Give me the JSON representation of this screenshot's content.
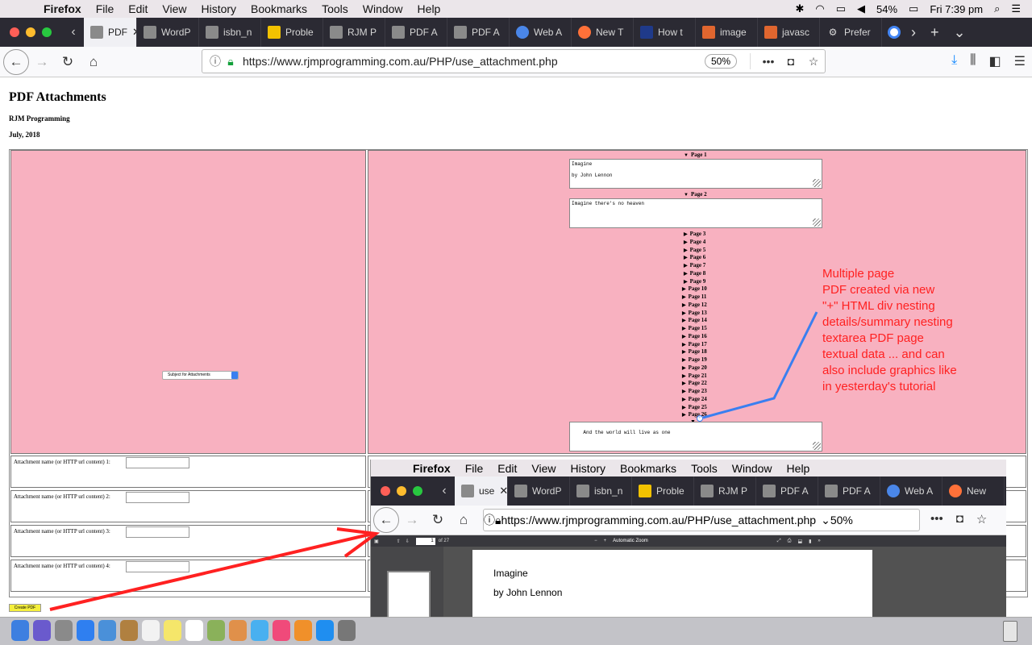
{
  "os_menubar": {
    "apple": "",
    "app": "Firefox",
    "items": [
      "File",
      "Edit",
      "View",
      "History",
      "Bookmarks",
      "Tools",
      "Window",
      "Help"
    ],
    "battery": "54%",
    "clock": "Fri 7:39 pm"
  },
  "tabs": [
    {
      "label": "PDF",
      "active": true
    },
    {
      "label": "WordP"
    },
    {
      "label": "isbn_n"
    },
    {
      "label": "Proble"
    },
    {
      "label": "RJM P"
    },
    {
      "label": "PDF A"
    },
    {
      "label": "PDF A"
    },
    {
      "label": "Web A"
    },
    {
      "label": "New T"
    },
    {
      "label": "How t"
    },
    {
      "label": "image"
    },
    {
      "label": "javasc"
    },
    {
      "label": "Prefer"
    }
  ],
  "toolbar": {
    "url": "https://www.rjmprogramming.com.au/PHP/use_attachment.php",
    "zoom": "50%"
  },
  "page": {
    "title": "PDF Attachments",
    "author": "RJM Programming",
    "date": "July, 2018",
    "subject_select": "Subject for Attachments",
    "pages": [
      {
        "label": "Page 1",
        "open": true,
        "text": "Imagine\n\nby John Lennon"
      },
      {
        "label": "Page 2",
        "open": true,
        "text": "Imagine there's no heaven"
      },
      {
        "label": "Page 3"
      },
      {
        "label": "Page 4"
      },
      {
        "label": "Page 5"
      },
      {
        "label": "Page 6"
      },
      {
        "label": "Page 7"
      },
      {
        "label": "Page 8"
      },
      {
        "label": "Page 9"
      },
      {
        "label": "Page 10"
      },
      {
        "label": "Page 11"
      },
      {
        "label": "Page 12"
      },
      {
        "label": "Page 13"
      },
      {
        "label": "Page 14"
      },
      {
        "label": "Page 15"
      },
      {
        "label": "Page 16"
      },
      {
        "label": "Page 17"
      },
      {
        "label": "Page 18"
      },
      {
        "label": "Page 19"
      },
      {
        "label": "Page 20"
      },
      {
        "label": "Page 21"
      },
      {
        "label": "Page 22"
      },
      {
        "label": "Page 23"
      },
      {
        "label": "Page 24"
      },
      {
        "label": "Page 25"
      },
      {
        "label": "Page 26"
      }
    ],
    "last_textarea": "And the world will live as one",
    "plus_label": "+",
    "attachments": [
      "Attachment name (or HTTP url content) 1:",
      "Attachment name (or HTTP url content) 2:",
      "Attachment name (or HTTP url content) 3:",
      "Attachment name (or HTTP url content) 4:"
    ],
    "create_button": "Create PDF"
  },
  "annotation": [
    "Multiple page",
    "PDF created via new",
    "\"+\" HTML div nesting",
    "details/summary nesting",
    "textarea PDF page",
    "textual data ... and can",
    "also include graphics like",
    "in yesterday's tutorial"
  ],
  "overlay": {
    "tabs": [
      "use",
      "WordP",
      "isbn_n",
      "Proble",
      "RJM P",
      "PDF A",
      "PDF A",
      "Web A",
      "New"
    ],
    "url": "https://www.rjmprogramming.com.au/PHP/use_attachment.php",
    "zoom": "50%",
    "page_num": "1",
    "page_of": "of 27",
    "zoom_mode": "Automatic Zoom",
    "pdf_line1": "Imagine",
    "pdf_line2": "by John Lennon"
  },
  "colors": {
    "pink": "#f8b1c0",
    "annotation_red": "#ff2121",
    "arrow_blue": "#3a7ff0",
    "button_yellow": "#f5ef3c"
  }
}
